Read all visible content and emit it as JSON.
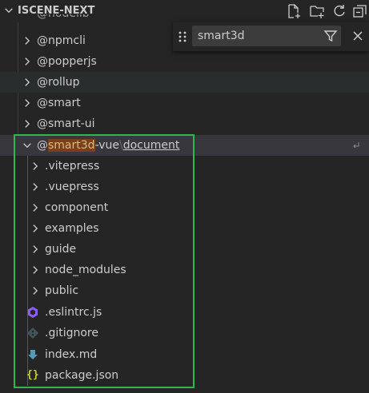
{
  "header": {
    "title": "ISCENE-NEXT"
  },
  "find": {
    "value": "smart3d"
  },
  "tree": {
    "partial_top": "@nodelib",
    "scoped": [
      {
        "label": "@npmcli"
      },
      {
        "label": "@popperjs"
      },
      {
        "label": "@rollup"
      },
      {
        "label": "@smart"
      },
      {
        "label": "@smart-ui"
      }
    ],
    "expanded": {
      "prefix": "@",
      "match": "smart3d",
      "suffix": "-vue",
      "sep": "\\",
      "sub": "document"
    },
    "children": [
      {
        "label": ".vitepress",
        "type": "folder"
      },
      {
        "label": ".vuepress",
        "type": "folder"
      },
      {
        "label": "component",
        "type": "folder"
      },
      {
        "label": "examples",
        "type": "folder"
      },
      {
        "label": "guide",
        "type": "folder"
      },
      {
        "label": "node_modules",
        "type": "folder"
      },
      {
        "label": "public",
        "type": "folder"
      },
      {
        "label": ".eslintrc.js",
        "type": "file",
        "icon": "eslint-icon"
      },
      {
        "label": ".gitignore",
        "type": "file",
        "icon": "git-icon"
      },
      {
        "label": "index.md",
        "type": "file",
        "icon": "markdown-icon"
      },
      {
        "label": "package.json",
        "type": "file",
        "icon": "json-icon"
      }
    ]
  },
  "colors": {
    "background": "#252526",
    "highlight_match": "#7b3f1c",
    "annotation_box": "#2fb84a",
    "eslint": "#8b5cf6",
    "markdown": "#519aba",
    "json": "#cbcb41",
    "git": "#41535b"
  }
}
